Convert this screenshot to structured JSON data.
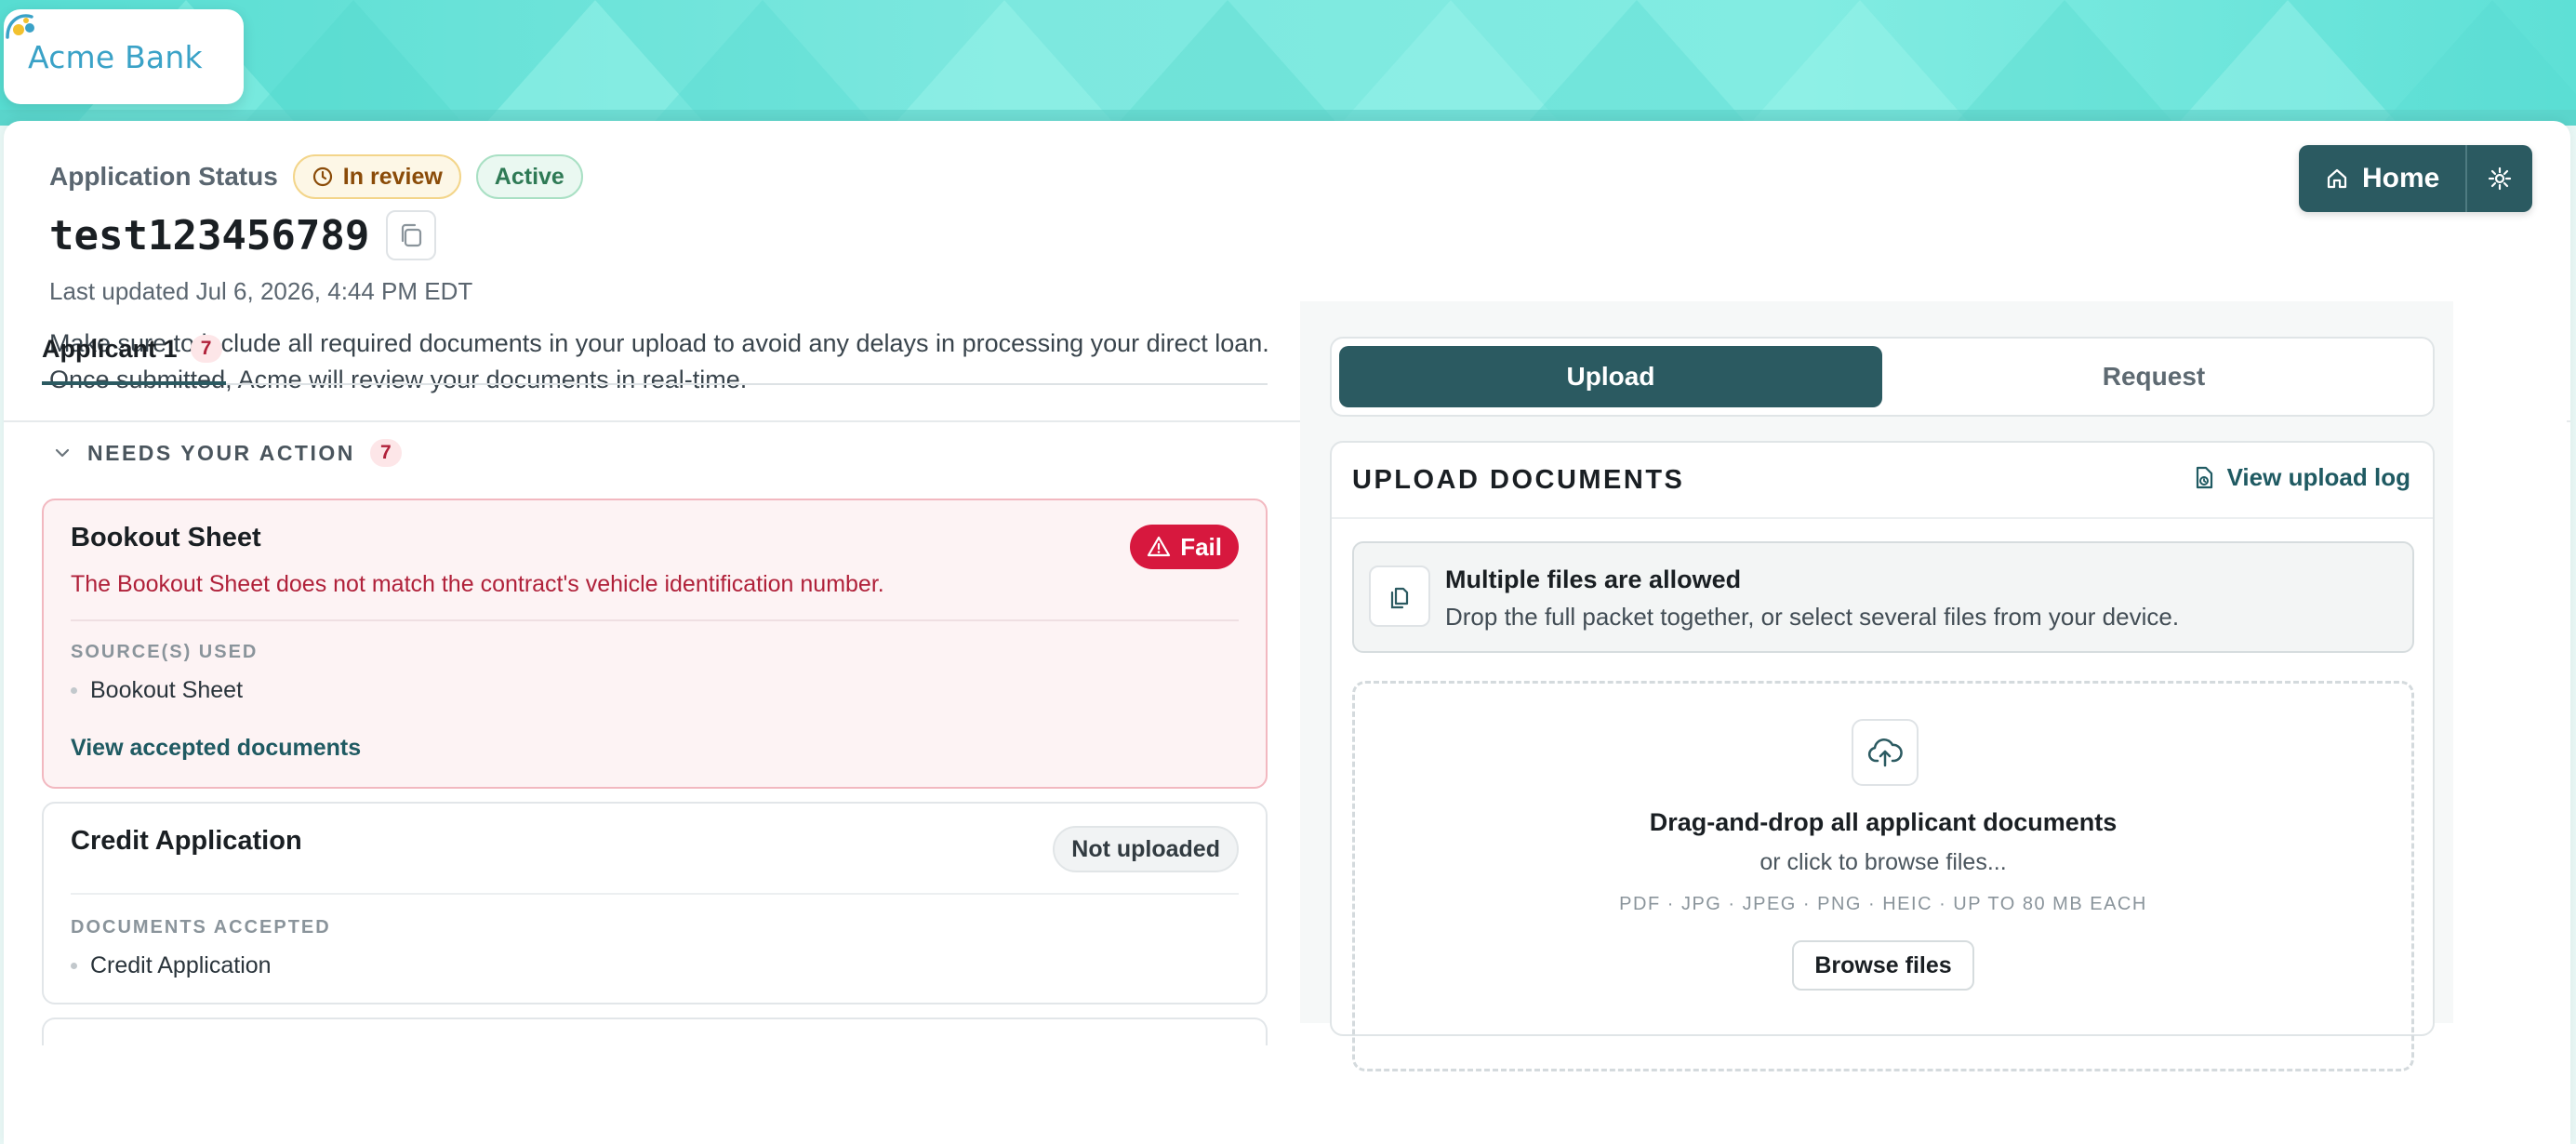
{
  "brand": {
    "name": "Acme Bank"
  },
  "header": {
    "status_label": "Application Status",
    "badges": {
      "review": "In review",
      "active": "Active"
    },
    "application_id": "test123456789",
    "last_updated": "Last updated Jul 6, 2026, 4:44 PM EDT",
    "intro": "Make sure to include all required documents in your upload to avoid any delays in processing your direct loan. Once submitted, Acme will review your documents in real-time.",
    "home_label": "Home"
  },
  "left": {
    "tab": {
      "label": "Applicant 1",
      "count": "7"
    },
    "section": {
      "title": "NEEDS YOUR ACTION",
      "count": "7"
    },
    "cards": [
      {
        "title": "Bookout Sheet",
        "badge": "Fail",
        "message": "The Bookout Sheet does not match the contract's vehicle identification number.",
        "meta_label": "SOURCE(S) USED",
        "items": [
          "Bookout Sheet"
        ],
        "link": "View accepted documents"
      },
      {
        "title": "Credit Application",
        "badge": "Not uploaded",
        "meta_label": "DOCUMENTS ACCEPTED",
        "items": [
          "Credit Application"
        ]
      }
    ]
  },
  "right": {
    "segments": {
      "upload": "Upload",
      "request": "Request"
    },
    "panel_title": "UPLOAD DOCUMENTS",
    "log_link": "View upload log",
    "info": {
      "title": "Multiple files are allowed",
      "subtitle": "Drop the full packet together, or select several files from your device."
    },
    "drop": {
      "title": "Drag-and-drop all applicant documents",
      "subtitle": "or click to browse files...",
      "types": "PDF · JPG · JPEG · PNG · HEIC · UP TO 80 MB EACH",
      "browse": "Browse files"
    }
  },
  "colors": {
    "brand_teal": "#2b5a61",
    "fail_red": "#d7183e",
    "banner": "#7de8df"
  }
}
